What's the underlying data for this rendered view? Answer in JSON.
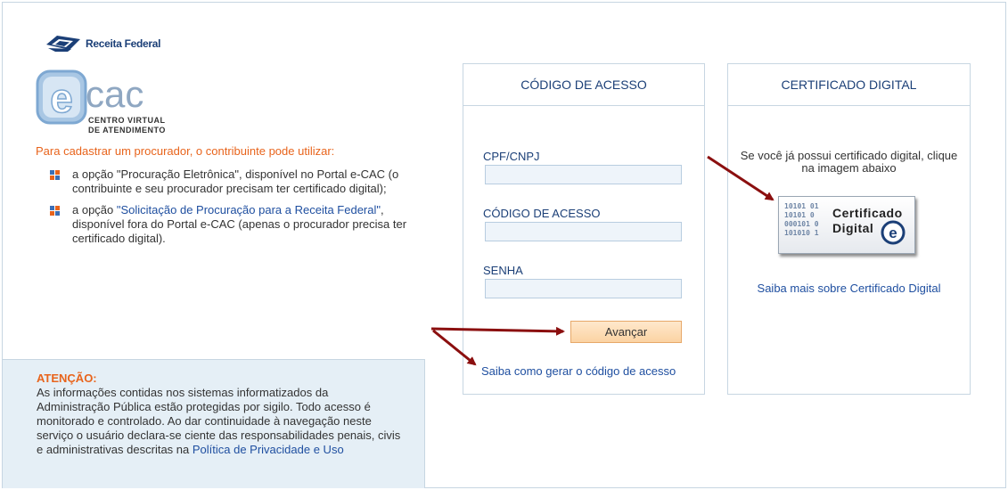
{
  "brand": {
    "receita_label": "Receita Federal",
    "ecac_word": "cac",
    "ecac_letter": "e",
    "ecac_subtitle_line1": "CENTRO VIRTUAL",
    "ecac_subtitle_line2": "DE ATENDIMENTO"
  },
  "intro": {
    "heading": "Para cadastrar um procurador, o contribuinte pode utilizar:",
    "option1_text": "a opção \"Procuração Eletrônica\", disponível no Portal e-CAC (o contribuinte e seu procurador precisam ter certificado digital);",
    "option2_prefix": "a opção ",
    "option2_link": "\"Solicitação de Procuração para a Receita Federal\"",
    "option2_suffix": ", disponível fora do Portal e-CAC (apenas o procurador precisa ter certificado digital)."
  },
  "attention": {
    "title": "ATENÇÃO:",
    "text": "As informações contidas nos sistemas informatizados da Administração Pública estão protegidas por sigilo. Todo acesso é monitorado e controlado. Ao dar continuidade à navegação neste serviço o usuário declara-se ciente das responsabilidades penais, civis e administrativas descritas na ",
    "link": "Política de Privacidade e Uso"
  },
  "access_panel": {
    "title": "CÓDIGO DE ACESSO",
    "cpf_label": "CPF/CNPJ",
    "cpf_value": "",
    "code_label": "CÓDIGO DE ACESSO",
    "code_value": "",
    "password_label": "SENHA",
    "password_value": "",
    "submit_label": "Avançar",
    "help_link": "Saiba como gerar o código de acesso"
  },
  "cert_panel": {
    "title": "CERTIFICADO DIGITAL",
    "instruction": "Se você já possui certificado digital, clique na imagem abaixo",
    "image_word1": "Certificado",
    "image_word2": "Digital",
    "image_bits": "10101 01\n10101 0\n000101 0\n101010 1",
    "more_link": "Saiba mais sobre Certificado Digital"
  },
  "colors": {
    "accent_orange": "#e8641c",
    "link_blue": "#1f4fa0",
    "heading_navy": "#1b3f77",
    "arrow_red": "#8b0f0f",
    "attention_bg": "#e5eff6"
  }
}
